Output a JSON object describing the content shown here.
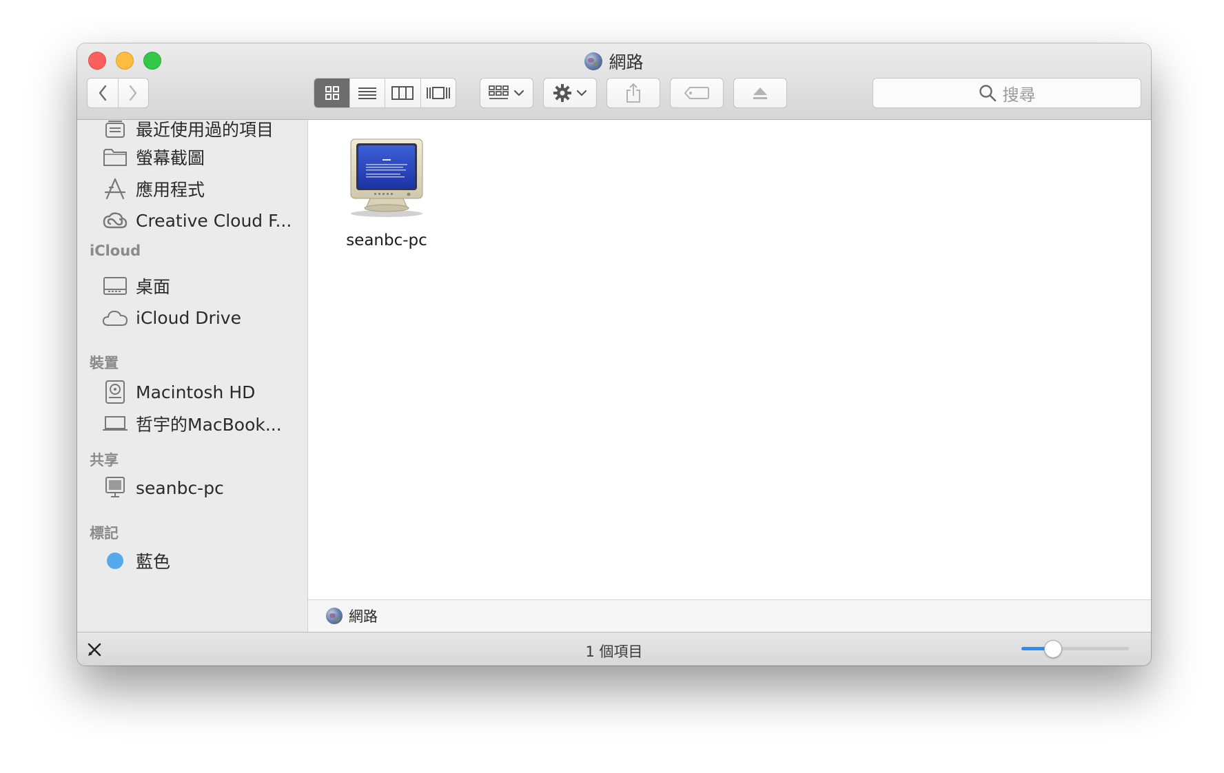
{
  "window": {
    "title": "網路"
  },
  "toolbar": {
    "view_modes": [
      "icon-view",
      "list-view",
      "column-view",
      "cover-flow-view"
    ],
    "active_view": "icon-view",
    "search_placeholder": "搜尋"
  },
  "sidebar": {
    "items_top": [
      {
        "label": "最近使用過的項目",
        "icon": "recents-icon"
      },
      {
        "label": "螢幕截圖",
        "icon": "folder-icon"
      },
      {
        "label": "應用程式",
        "icon": "applications-icon"
      },
      {
        "label": "Creative Cloud F...",
        "icon": "creative-cloud-icon"
      }
    ],
    "icloud": {
      "header": "iCloud",
      "items": [
        {
          "label": "桌面",
          "icon": "desktop-icon"
        },
        {
          "label": "iCloud Drive",
          "icon": "cloud-icon"
        }
      ]
    },
    "devices": {
      "header": "裝置",
      "items": [
        {
          "label": "Macintosh HD",
          "icon": "hard-drive-icon"
        },
        {
          "label": "哲宇的MacBook...",
          "icon": "laptop-icon"
        }
      ]
    },
    "shared": {
      "header": "共享",
      "items": [
        {
          "label": "seanbc-pc",
          "icon": "pc-icon"
        }
      ]
    },
    "tags": {
      "header": "標記",
      "items": [
        {
          "label": "藍色",
          "color": "#54a8ec"
        }
      ]
    }
  },
  "content": {
    "items": [
      {
        "label": "seanbc-pc",
        "icon": "windows-pc-icon"
      }
    ]
  },
  "pathbar": {
    "label": "網路"
  },
  "statusbar": {
    "item_count": "1 個項目",
    "icon_size_level": 0.25
  },
  "colors": {
    "accent": "#2b8cf6",
    "tag_blue": "#54a8ec"
  }
}
